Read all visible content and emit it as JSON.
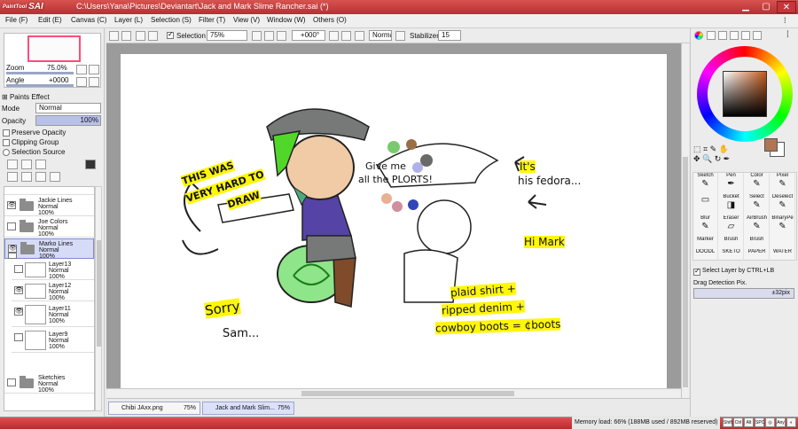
{
  "window": {
    "title": "C:\\Users\\Yana\\Pictures\\Deviantart\\Jack and Mark Slime Rancher.sai (*)",
    "logo": "SAI",
    "logo_small": "PaintTool"
  },
  "menu": [
    "File (F)",
    "Edit (E)",
    "Canvas (C)",
    "Layer (L)",
    "Selection (S)",
    "Filter (T)",
    "View (V)",
    "Window (W)",
    "Others (O)"
  ],
  "toolbar": {
    "selection_label": "Selection",
    "zoom": "75%",
    "rotation": "+000°",
    "blend": "Normal",
    "stabilizer_label": "Stabilizer",
    "stabilizer_value": "15"
  },
  "navigator": {
    "zoom_label": "Zoom",
    "zoom_value": "75.0%",
    "angle_label": "Angle",
    "angle_value": "+0000"
  },
  "layer_props": {
    "paints_effect": "Paints Effect",
    "mode_label": "Mode",
    "mode_value": "Normal",
    "opacity_label": "Opacity",
    "opacity_value": "100%",
    "preserve_opacity": "Preserve Opacity",
    "clipping_group": "Clipping Group",
    "selection_source": "Selection Source"
  },
  "layers": [
    {
      "name": "Jackie Lines",
      "mode": "Normal",
      "opacity": "100%",
      "type": "folder",
      "visible": true,
      "selected": false
    },
    {
      "name": "Joe Colors",
      "mode": "Normal",
      "opacity": "100%",
      "type": "folder",
      "visible": false,
      "selected": false
    },
    {
      "name": "Marko Lines",
      "mode": "Normal",
      "opacity": "100%",
      "type": "folder",
      "visible": true,
      "selected": true
    },
    {
      "name": "Layer13",
      "mode": "Normal",
      "opacity": "100%",
      "type": "layer",
      "visible": false,
      "selected": false
    },
    {
      "name": "Layer12",
      "mode": "Normal",
      "opacity": "100%",
      "type": "layer",
      "visible": true,
      "selected": false
    },
    {
      "name": "Layer11",
      "mode": "Normal",
      "opacity": "100%",
      "type": "layer",
      "visible": true,
      "selected": false
    },
    {
      "name": "Layer9",
      "mode": "Normal",
      "opacity": "100%",
      "type": "layer",
      "visible": false,
      "selected": false
    },
    {
      "name": "Sketchies",
      "mode": "Normal",
      "opacity": "100%",
      "type": "folder",
      "visible": false,
      "selected": false
    }
  ],
  "tabs": [
    {
      "name": "Chibi JAxx.png",
      "zoom": "75%",
      "active": false
    },
    {
      "name": "Jack and Mark Slim...",
      "zoom": "75%",
      "active": true
    }
  ],
  "tools": [
    "Sketch",
    "Pen",
    "Color",
    "Pixel",
    "",
    "Bucket",
    "Select",
    "Deselect",
    "Blur",
    "Eraser",
    "AirBrush",
    "BinaryPe",
    "Marker",
    "Brush",
    "Brush",
    "",
    "DOODL",
    "SKETO",
    "PAPER",
    "WATER"
  ],
  "right_panel": {
    "select_layer": "Select Layer by CTRL+LB",
    "drag_label": "Drag Detection Pix.",
    "drag_value": "±32pix"
  },
  "status": {
    "memory": "Memory load: 66% (188MB used / 892MB reserved)",
    "keys": [
      "Shift",
      "Ctrl",
      "Alt",
      "SPC",
      "◎",
      "Any",
      "◐"
    ]
  },
  "artwork": {
    "text1": "THIS WAS",
    "text2": "VERY HARD TO",
    "text3": "DRAW",
    "text4": "Give me",
    "text5": "all the PLORTS!",
    "text6": "It's",
    "text7": "his fedora...",
    "text8": "Hi Mark",
    "text9": "plaid shirt +",
    "text10": "ripped denim +",
    "text11": "cowboy boots = ¢boots",
    "text12": "Sorry",
    "text13": "Sam...",
    "colors": {
      "skin": "#f0cba5",
      "hair": "#51d72a",
      "hat": "#777878",
      "slime": "#8fe58a",
      "shirt": "#5643a6",
      "brown": "#7f4b2a",
      "highlight": "#fff60a",
      "fg_color": "#b07552"
    }
  }
}
